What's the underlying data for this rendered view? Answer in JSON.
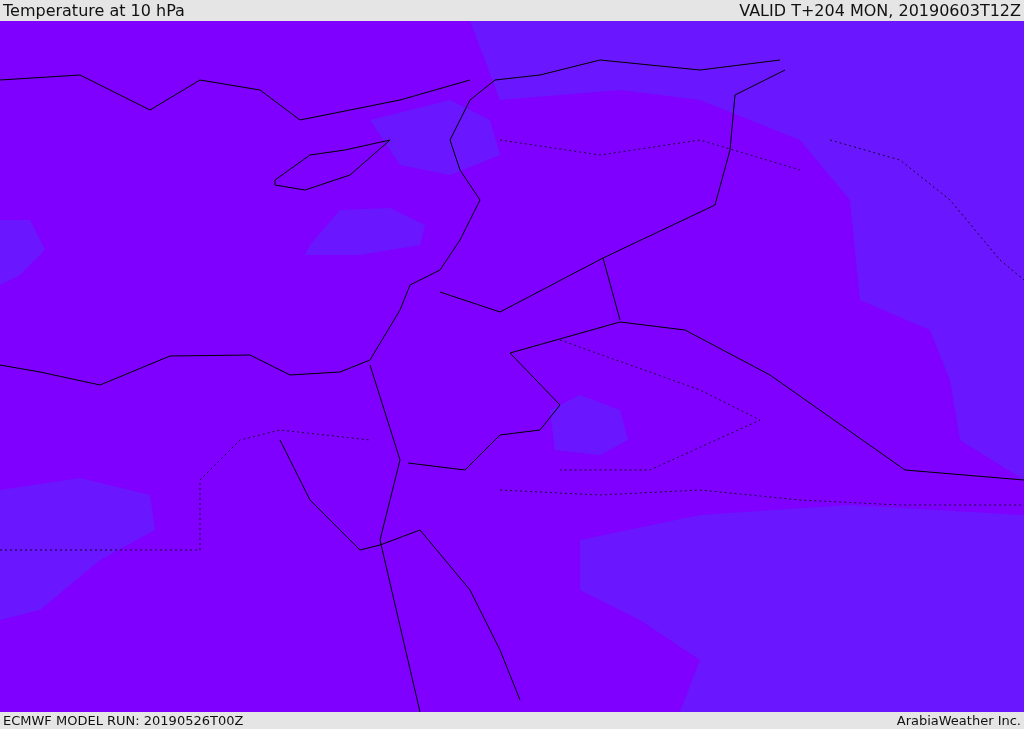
{
  "header": {
    "title": "Temperature at 10 hPa",
    "valid": "VALID T+204 MON, 20190603T12Z"
  },
  "footer": {
    "model_run": "ECMWF MODEL RUN: 20190526T00Z",
    "credit": "ArabiaWeather Inc."
  }
}
